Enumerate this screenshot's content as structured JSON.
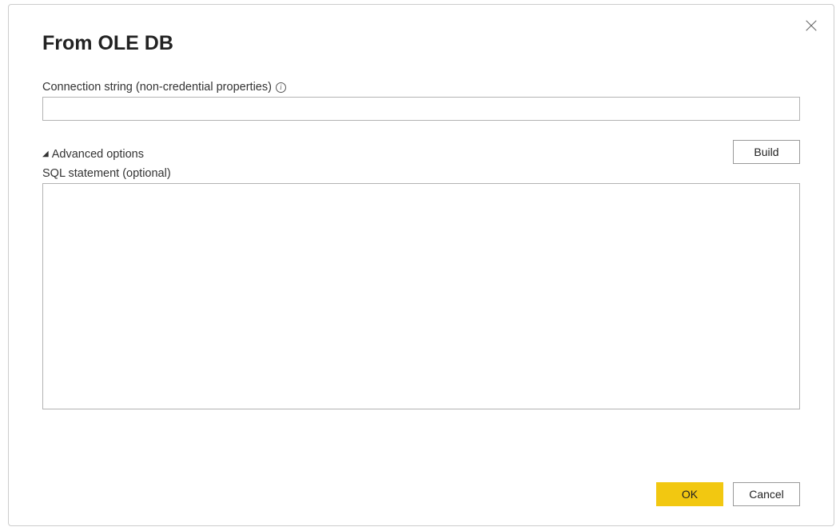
{
  "dialog": {
    "title": "From OLE DB",
    "connection_label": "Connection string (non-credential properties)",
    "connection_value": "",
    "build_button": "Build",
    "advanced_toggle": "Advanced options",
    "sql_label": "SQL statement (optional)",
    "sql_value": "",
    "ok_button": "OK",
    "cancel_button": "Cancel",
    "info_tooltip": "i"
  }
}
